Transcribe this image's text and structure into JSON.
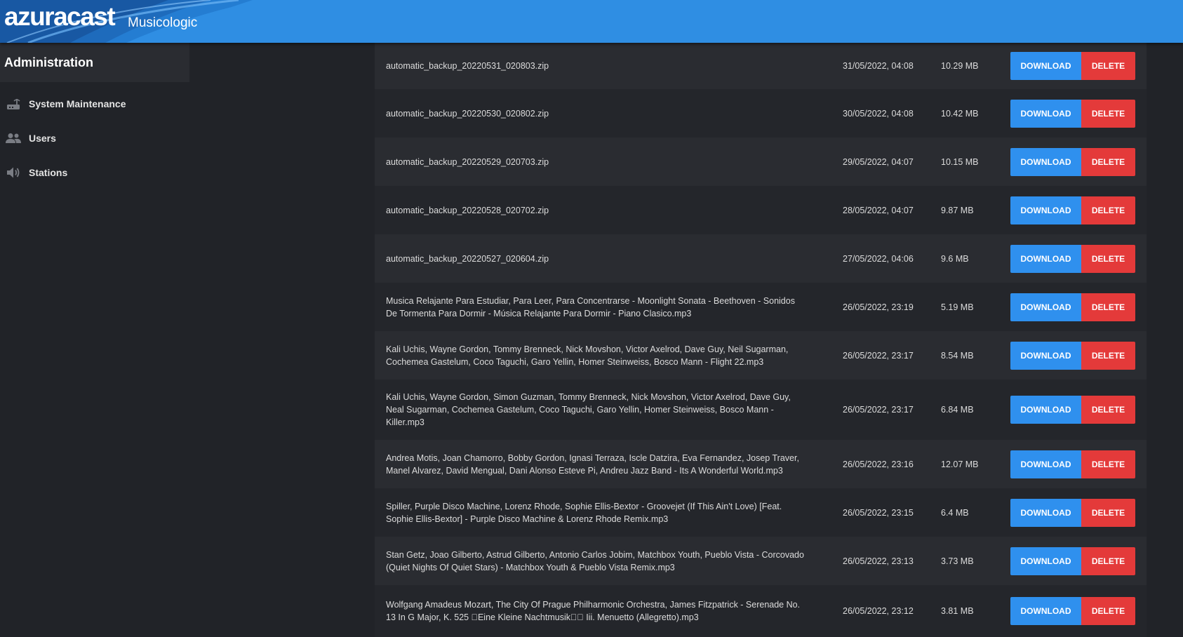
{
  "navbar": {
    "brand": "azuracast",
    "station": "Musicologic"
  },
  "sidebar": {
    "header": "Administration",
    "items": [
      {
        "label": "System Maintenance",
        "icon": "router-icon"
      },
      {
        "label": "Users",
        "icon": "users-icon"
      },
      {
        "label": "Stations",
        "icon": "speaker-icon"
      }
    ]
  },
  "table": {
    "download_label": "DOWNLOAD",
    "delete_label": "DELETE",
    "rows": [
      {
        "name": "automatic_backup_20220531_020803.zip",
        "date": "31/05/2022, 04:08",
        "size": "10.29 MB"
      },
      {
        "name": "automatic_backup_20220530_020802.zip",
        "date": "30/05/2022, 04:08",
        "size": "10.42 MB"
      },
      {
        "name": "automatic_backup_20220529_020703.zip",
        "date": "29/05/2022, 04:07",
        "size": "10.15 MB"
      },
      {
        "name": "automatic_backup_20220528_020702.zip",
        "date": "28/05/2022, 04:07",
        "size": "9.87 MB"
      },
      {
        "name": "automatic_backup_20220527_020604.zip",
        "date": "27/05/2022, 04:06",
        "size": "9.6 MB"
      },
      {
        "name": "Musica Relajante Para Estudiar, Para Leer, Para Concentrarse - Moonlight Sonata - Beethoven - Sonidos De Tormenta Para Dormir - Música Relajante Para Dormir - Piano Clasico.mp3",
        "date": "26/05/2022, 23:19",
        "size": "5.19 MB"
      },
      {
        "name": "Kali Uchis, Wayne Gordon, Tommy Brenneck, Nick Movshon, Victor Axelrod, Dave Guy, Neil Sugarman, Cochemea Gastelum, Coco Taguchi, Garo Yellin, Homer Steinweiss, Bosco Mann - Flight 22.mp3",
        "date": "26/05/2022, 23:17",
        "size": "8.54 MB"
      },
      {
        "name": "Kali Uchis, Wayne Gordon, Simon Guzman, Tommy Brenneck, Nick Movshon, Victor Axelrod, Dave Guy, Neal Sugarman, Cochemea Gastelum, Coco Taguchi, Garo Yellin, Homer Steinweiss, Bosco Mann - Killer.mp3",
        "date": "26/05/2022, 23:17",
        "size": "6.84 MB"
      },
      {
        "name": "Andrea Motis, Joan Chamorro, Bobby Gordon, Ignasi Terraza, Iscle Datzira, Eva Fernandez, Josep Traver, Manel Alvarez, David Mengual, Dani Alonso Esteve Pi, Andreu Jazz Band - Its A Wonderful World.mp3",
        "date": "26/05/2022, 23:16",
        "size": "12.07 MB"
      },
      {
        "name": "Spiller, Purple Disco Machine, Lorenz Rhode, Sophie Ellis-Bextor - Groovejet (If This Ain't Love) [Feat. Sophie Ellis-Bextor] - Purple Disco Machine & Lorenz Rhode Remix.mp3",
        "date": "26/05/2022, 23:15",
        "size": "6.4 MB"
      },
      {
        "name": "Stan Getz, Joao Gilberto, Astrud Gilberto, Antonio Carlos Jobim, Matchbox Youth, Pueblo Vista - Corcovado (Quiet Nights Of Quiet Stars) - Matchbox Youth & Pueblo Vista Remix.mp3",
        "date": "26/05/2022, 23:13",
        "size": "3.73 MB"
      },
      {
        "name": "Wolfgang Amadeus Mozart, The City Of Prague Philharmonic Orchestra, James Fitzpatrick - Serenade No. 13 In G Major, K. 525 \u0000Eine Kleine Nachtmusik\u0000\u0000 Iii. Menuetto (Allegretto).mp3",
        "date": "26/05/2022, 23:12",
        "size": "3.81 MB"
      }
    ]
  }
}
